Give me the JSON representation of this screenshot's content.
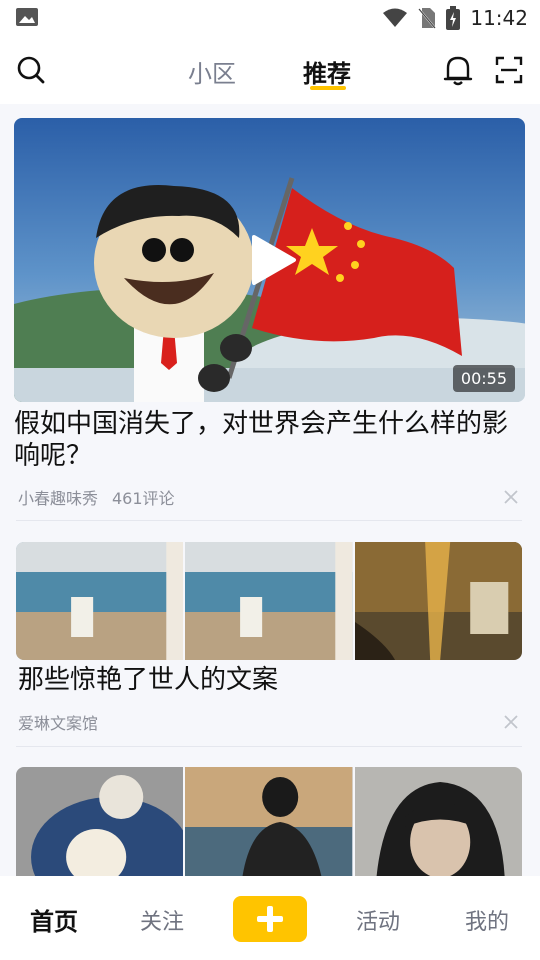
{
  "status": {
    "time": "11:42"
  },
  "top_tabs": [
    {
      "label": "小区"
    },
    {
      "label": "推荐"
    }
  ],
  "feed": {
    "post1": {
      "title": "假如中国消失了，对世界会产生什么样的影响呢？",
      "author": "小春趣味秀",
      "comments": "461评论",
      "duration": "00:55"
    },
    "post2": {
      "title": "那些惊艳了世人的文案",
      "author": "爱琳文案馆"
    }
  },
  "bottom_nav": [
    {
      "label": "首页"
    },
    {
      "label": "关注"
    },
    {
      "label": "活动"
    },
    {
      "label": "我的"
    }
  ],
  "colors": {
    "accent": "#ffc400",
    "muted": "#8c8f99"
  }
}
